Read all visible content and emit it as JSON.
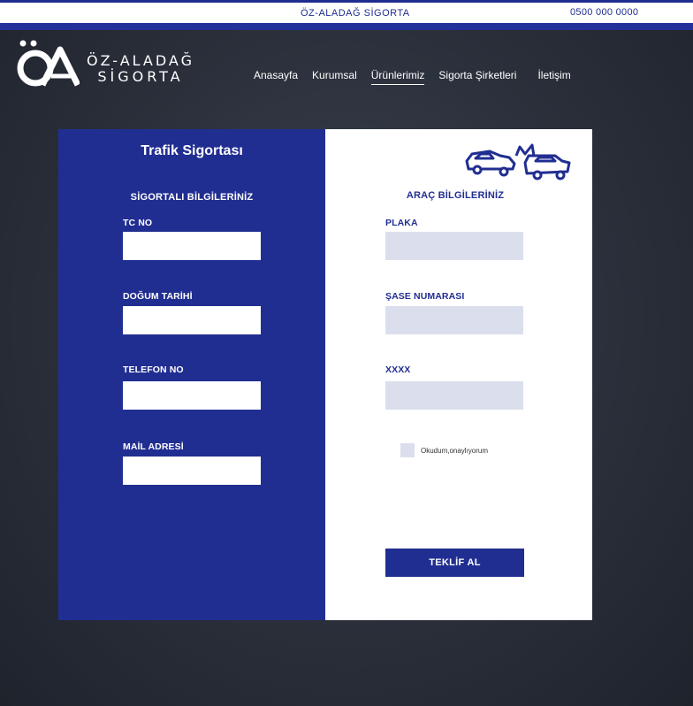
{
  "topbar": {
    "brand": "ÖZ-ALADAĞ SİGORTA",
    "phone": "0500 000 0000"
  },
  "logo": {
    "line1": "ÖZ-ALADAĞ",
    "line2": "SİGORTA",
    "mark": "oz-aladag-logo-icon"
  },
  "nav": {
    "items": [
      {
        "label": "Anasayfa",
        "active": false
      },
      {
        "label": "Kurumsal",
        "active": false
      },
      {
        "label": "Ürünlerimiz",
        "active": true
      },
      {
        "label": "Sigorta Şirketleri",
        "active": false
      },
      {
        "label": "İletişim",
        "active": false
      }
    ]
  },
  "form": {
    "title": "Trafik Sigortası",
    "insured": {
      "title": "SİGORTALI BİLGİLERİNİZ",
      "fields": [
        {
          "label": "TC NO",
          "value": ""
        },
        {
          "label": "DOĞUM TARİHİ",
          "value": ""
        },
        {
          "label": "TELEFON NO",
          "value": ""
        },
        {
          "label": "MAİL ADRESİ",
          "value": ""
        }
      ]
    },
    "vehicle": {
      "title": "ARAÇ BİLGİLERİNİZ",
      "icon": "car-crash-icon",
      "fields": [
        {
          "label": "PLAKA",
          "value": ""
        },
        {
          "label": "ŞASE NUMARASI",
          "value": ""
        },
        {
          "label": "XXXX",
          "value": ""
        }
      ]
    },
    "consent": {
      "label": "Okudum,onaylıyorum",
      "checked": false
    },
    "submit_label": "TEKLİF AL"
  },
  "colors": {
    "primary": "#212e91",
    "input_light": "#dbdfed",
    "background": "#2a2f3a"
  }
}
